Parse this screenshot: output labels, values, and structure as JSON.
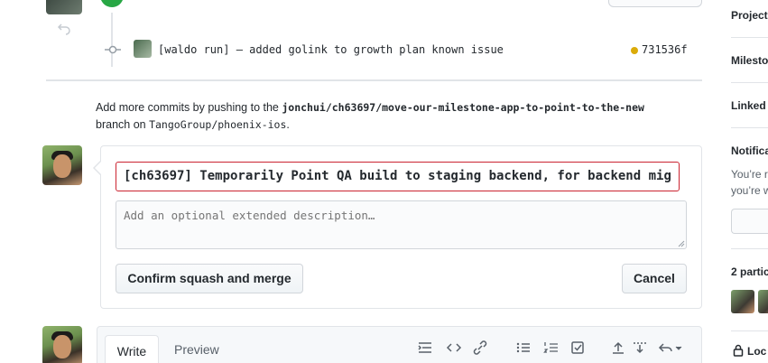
{
  "timeline": {
    "commit": {
      "message": "[waldo run] – added golink to growth plan known issue",
      "sha": "731536f",
      "status_color": "#dbab09"
    }
  },
  "push_hint": {
    "prefix": "Add more commits by pushing to the ",
    "branch": "jonchui/ch63697/move-our-milestone-app-to-point-to-the-new",
    "middle": " branch on ",
    "repo": "TangoGroup/phoenix-ios",
    "suffix": "."
  },
  "merge_form": {
    "title_value": "[ch63697] Temporarily Point QA build to staging backend, for backend mig",
    "description_placeholder": "Add an optional extended description…",
    "confirm_label": "Confirm squash and merge",
    "cancel_label": "Cancel"
  },
  "comment_form": {
    "tabs": {
      "write": "Write",
      "preview": "Preview"
    },
    "toolbar_icons": [
      "heading-icon",
      "code-icon",
      "link-icon",
      "unordered-list-icon",
      "ordered-list-icon",
      "task-list-icon",
      "upload-icon",
      "mention-icon",
      "reply-icon"
    ]
  },
  "sidebar": {
    "projects": "Project",
    "milestone": "Milesto",
    "linked": "Linked",
    "notifications": "Notifica",
    "notifications_text_1": "You’re r",
    "notifications_text_2": "you’re w",
    "participants": "2 partic",
    "lock": "Loc"
  },
  "colors": {
    "merged": "#28a745",
    "error_border": "#cb2431",
    "border": "#e1e4e8"
  }
}
